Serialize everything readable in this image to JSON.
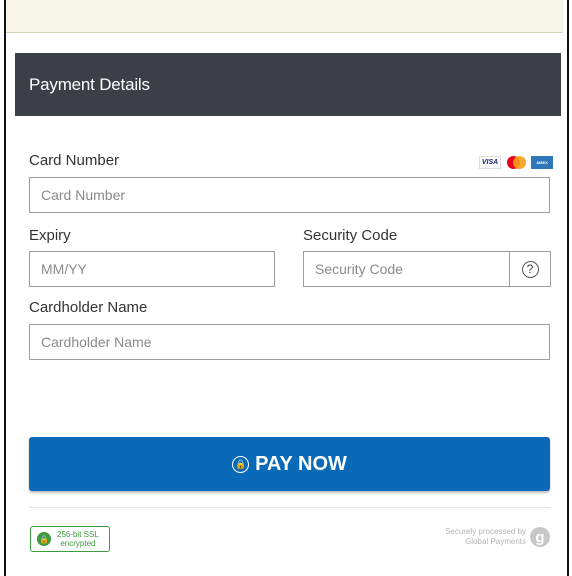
{
  "header": {
    "title": "Payment Details"
  },
  "card_number": {
    "label": "Card Number",
    "placeholder": "Card Number"
  },
  "card_brands": [
    {
      "name": "visa-icon",
      "text": "VISA"
    },
    {
      "name": "mastercard-icon",
      "text": ""
    },
    {
      "name": "amex-icon",
      "text": "AMEX"
    }
  ],
  "expiry": {
    "label": "Expiry",
    "placeholder": "MM/YY"
  },
  "security_code": {
    "label": "Security Code",
    "placeholder": "Security Code",
    "help": "?"
  },
  "cardholder": {
    "label": "Cardholder Name",
    "placeholder": "Cardholder Name"
  },
  "pay_button": {
    "label": "PAY NOW"
  },
  "ssl_badge": {
    "line1": "256-bit SSL",
    "line2": "encrypted"
  },
  "processor": {
    "line1": "Securely processed by",
    "line2": "Global Payments",
    "logo": "g"
  },
  "colors": {
    "header_bg": "#3d3f46",
    "pay_button": "#0a6ab8",
    "ssl_green": "#3d9a3d"
  }
}
